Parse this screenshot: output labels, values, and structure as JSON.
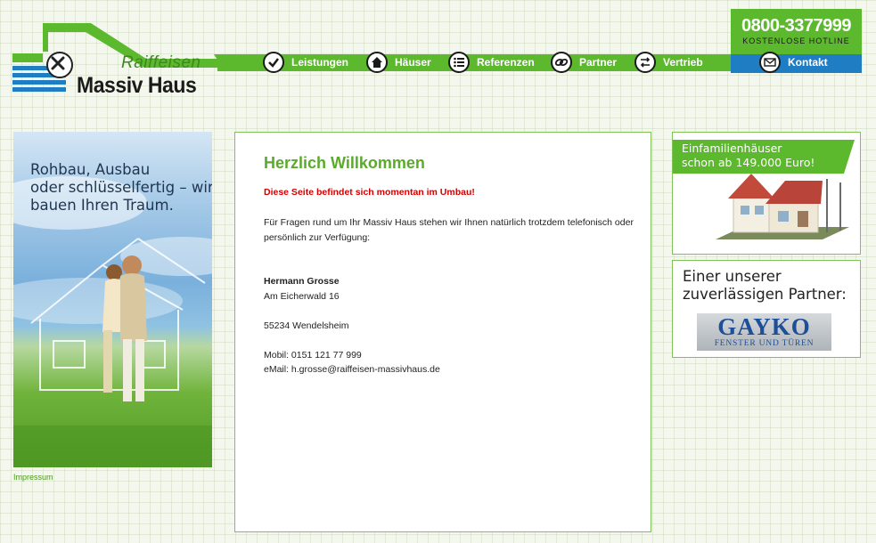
{
  "logo": {
    "brand": "Raiffeisen",
    "title": "Massiv Haus"
  },
  "hotline": {
    "number": "0800-3377999",
    "label": "KOSTENLOSE HOTLINE"
  },
  "nav": {
    "items": [
      {
        "label": "Leistungen",
        "icon": "check-icon"
      },
      {
        "label": "Häuser",
        "icon": "house-icon"
      },
      {
        "label": "Referenzen",
        "icon": "list-icon"
      },
      {
        "label": "Partner",
        "icon": "link-icon"
      },
      {
        "label": "Vertrieb",
        "icon": "exchange-icon"
      }
    ],
    "kontakt": {
      "label": "Kontakt",
      "icon": "mail-icon"
    }
  },
  "promo": {
    "line1": "Rohbau, Ausbau",
    "line2": "oder schlüsselfertig – wir",
    "line3": "bauen Ihren Traum."
  },
  "impressum": "Impressum",
  "main": {
    "title": "Herzlich Willkommen",
    "notice": "Diese Seite befindet sich momentan im Umbau!",
    "intro": "Für Fragen rund um Ihr Massiv Haus stehen wir Ihnen natürlich trotzdem telefonisch oder persönlich zur Verfügung:",
    "contact": {
      "name": "Hermann Grosse",
      "street": "Am Eicherwald 16",
      "city": "55234 Wendelsheim",
      "mobile": "Mobil: 0151 121 77 999",
      "email": "eMail: h.grosse@raiffeisen-massivhaus.de"
    }
  },
  "sidebar": {
    "offer": {
      "line1": "Einfamilienhäuser",
      "line2": "schon ab 149.000 Euro!"
    },
    "partner": {
      "line1": "Einer unserer",
      "line2": "zuverlässigen Partner:",
      "logo_main": "GAYKO",
      "logo_sub": "FENSTER UND TÜREN"
    }
  },
  "colors": {
    "green": "#5cb82d",
    "blue": "#1f7dc4",
    "red": "#d40000"
  }
}
